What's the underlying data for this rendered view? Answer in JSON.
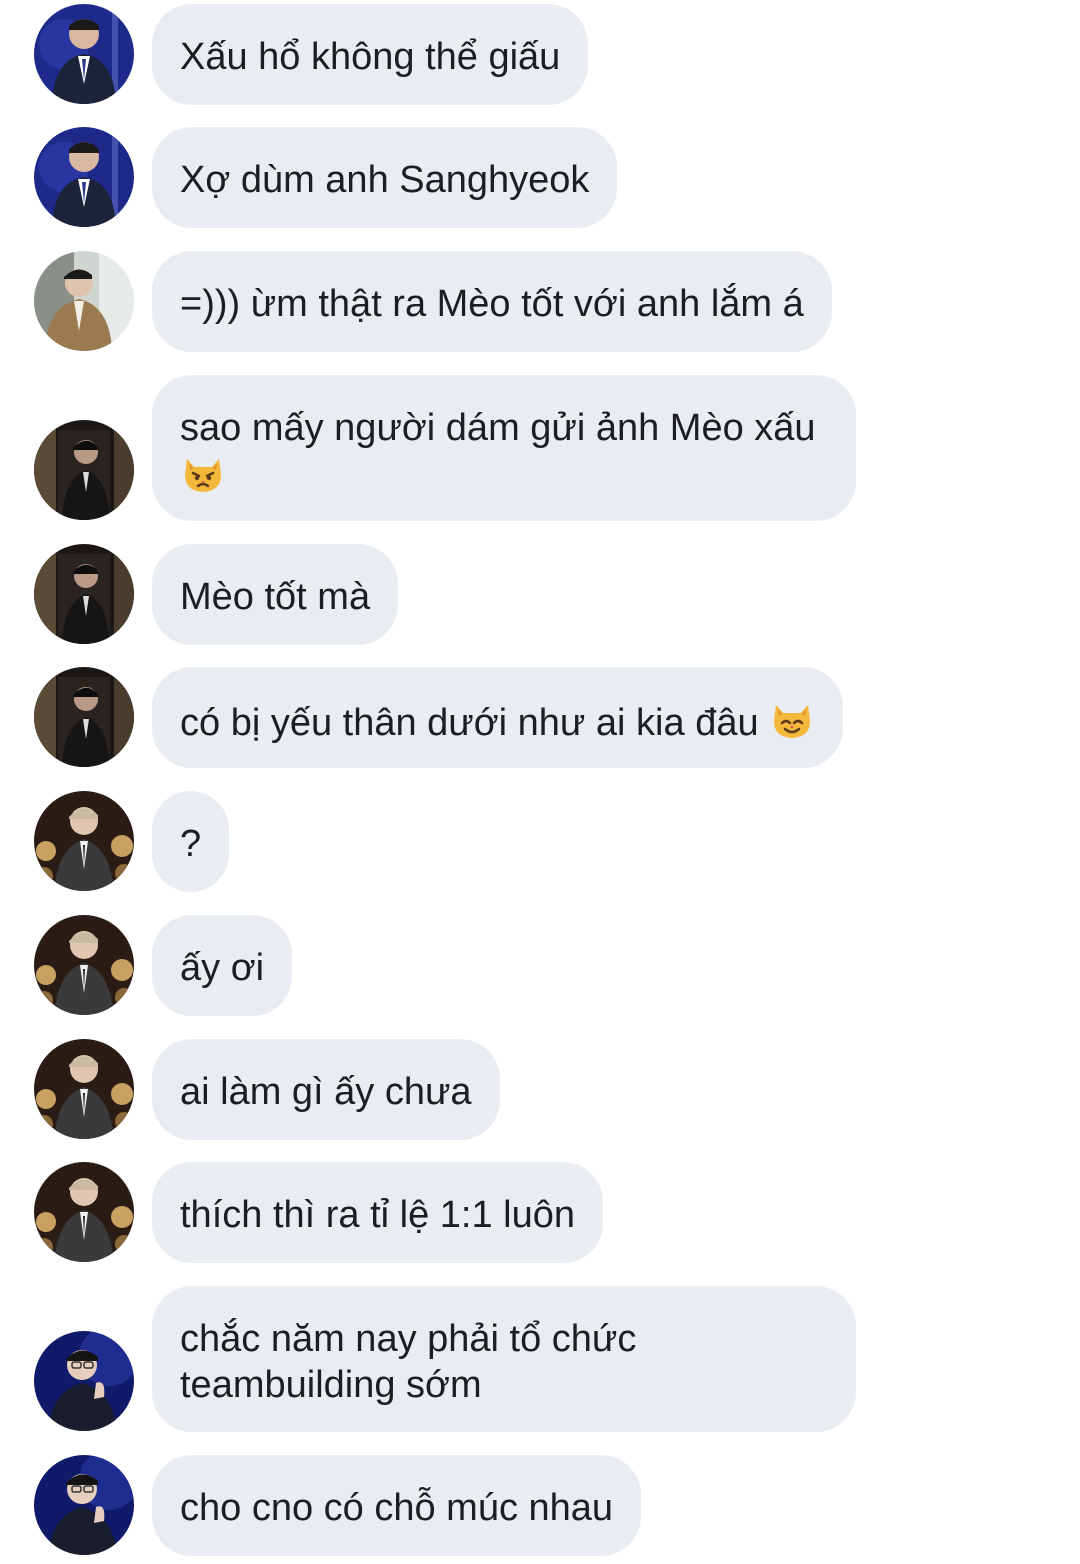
{
  "messages": [
    {
      "avatar": "navy-suit-stage",
      "text": "Xấu hổ không thể giấu"
    },
    {
      "avatar": "navy-suit-stage",
      "text": "Xợ dùm anh Sanghyeok"
    },
    {
      "avatar": "brown-blazer-gallery",
      "text": "=))) ừm thật ra Mèo tốt với anh lắm á"
    },
    {
      "avatar": "dark-suit-shadow",
      "text": "sao mấy người dám gửi ảnh Mèo xấu",
      "emoji": "pouting-cat-icon"
    },
    {
      "avatar": "dark-suit-shadow",
      "text": "Mèo tốt mà"
    },
    {
      "avatar": "dark-suit-shadow",
      "text": "có bị yếu thân dưới như ai kia đâu",
      "emoji": "smiling-cat-icon"
    },
    {
      "avatar": "grey-suit-trophies",
      "text": "?"
    },
    {
      "avatar": "grey-suit-trophies",
      "text": "ấy ơi"
    },
    {
      "avatar": "grey-suit-trophies",
      "text": "ai làm gì ấy chưa"
    },
    {
      "avatar": "grey-suit-trophies",
      "text": "thích thì ra tỉ lệ 1:1 luôn"
    },
    {
      "avatar": "glasses-blue-stage",
      "text": "chắc năm nay phải tổ chức teambuilding sớm"
    },
    {
      "avatar": "glasses-blue-stage",
      "text": "cho cno có chỗ múc nhau"
    }
  ],
  "colors": {
    "background": "#ffffff",
    "bubble": "#e9ecf0",
    "text": "#1c1e21"
  }
}
